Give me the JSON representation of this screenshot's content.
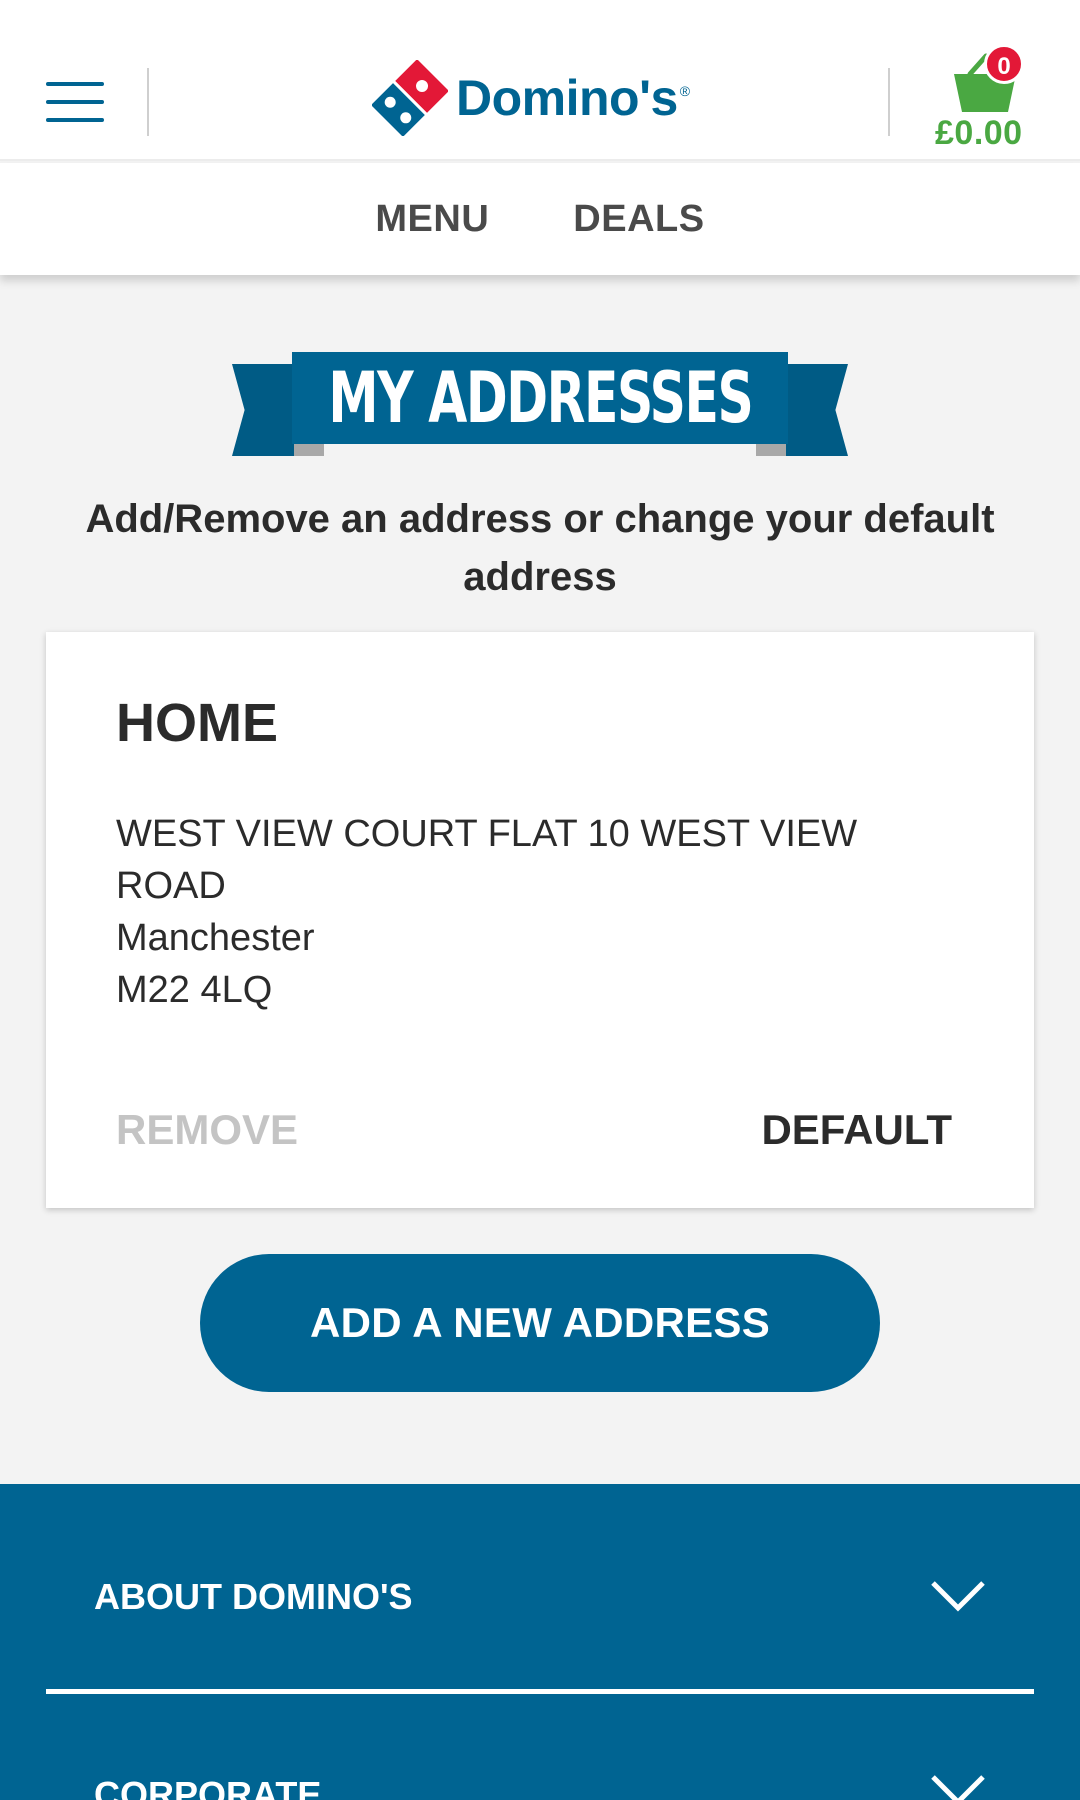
{
  "header": {
    "brand": "Domino's",
    "registered_mark": "®",
    "basket": {
      "count": "0",
      "total": "£0.00"
    }
  },
  "nav": {
    "items": [
      {
        "label": "MENU"
      },
      {
        "label": "DEALS"
      }
    ]
  },
  "page": {
    "title": "MY ADDRESSES",
    "subtitle": "Add/Remove an address or change your default address"
  },
  "addresses": [
    {
      "name": "HOME",
      "line1": "WEST VIEW COURT FLAT 10 WEST VIEW ROAD",
      "city": "Manchester",
      "postcode": "M22 4LQ",
      "remove_label": "REMOVE",
      "default_label": "DEFAULT"
    }
  ],
  "add_button": {
    "label": "ADD A NEW ADDRESS"
  },
  "footer": {
    "sections": [
      {
        "label": "ABOUT DOMINO'S"
      },
      {
        "label": "CORPORATE"
      }
    ]
  },
  "colors": {
    "brand_blue": "#006492",
    "brand_red": "#e31837",
    "basket_green": "#4aa842",
    "disabled_grey": "#c4c4c4"
  },
  "icons": [
    "hamburger-menu-icon",
    "dominos-logo-icon",
    "basket-icon",
    "chevron-down-icon"
  ]
}
